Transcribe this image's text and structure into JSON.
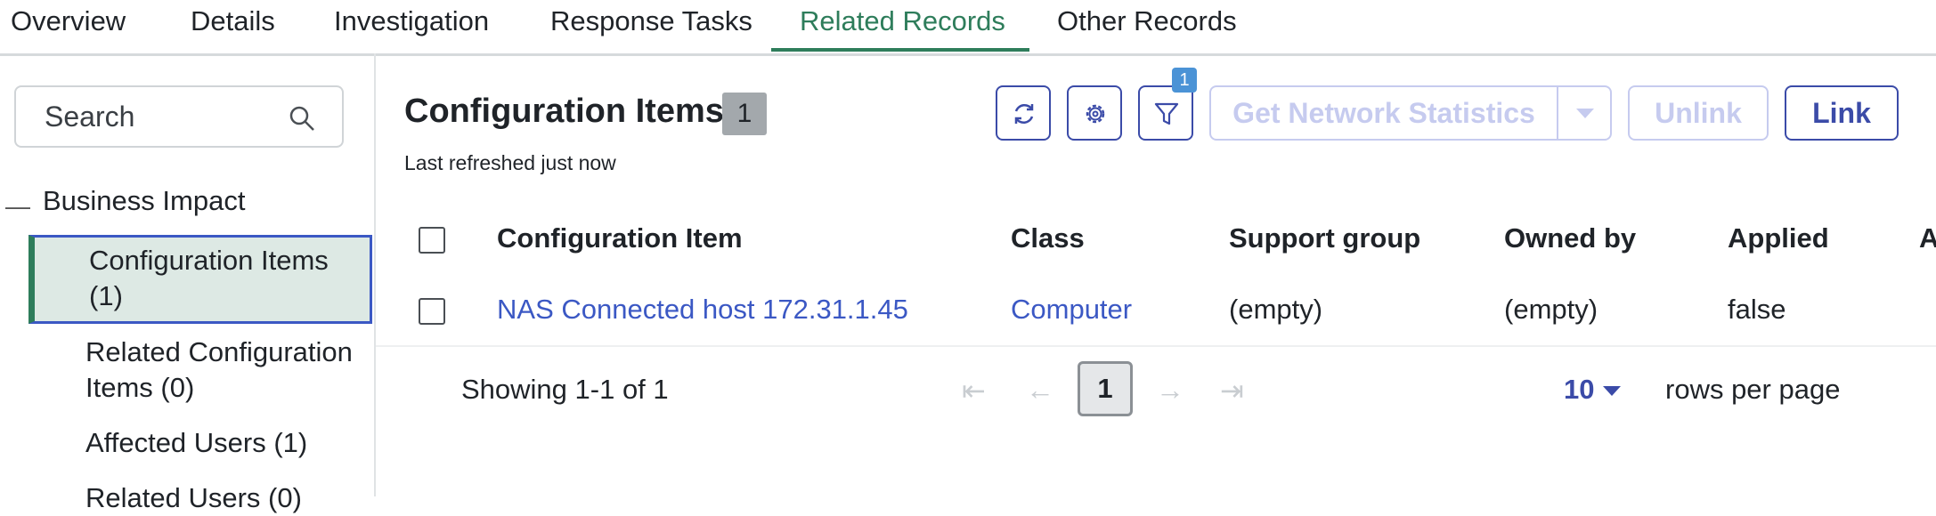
{
  "tabs": [
    {
      "label": "Overview"
    },
    {
      "label": "Details"
    },
    {
      "label": "Investigation"
    },
    {
      "label": "Response Tasks"
    },
    {
      "label": "Related Records",
      "active": true
    },
    {
      "label": "Other Records"
    }
  ],
  "sidebar": {
    "search_text": "Search",
    "group_label": "Business Impact",
    "items": [
      {
        "label": "Configuration Items (1)",
        "selected": true
      },
      {
        "label": "Related Configuration Items (0)"
      },
      {
        "label": "Affected Users (1)"
      },
      {
        "label": "Related Users (0)"
      }
    ]
  },
  "main": {
    "title": "Configuration Items",
    "count": "1",
    "refreshed": "Last refreshed just now",
    "filter_count": "1",
    "buttons": {
      "network_stats": "Get Network Statistics",
      "unlink": "Unlink",
      "link": "Link"
    }
  },
  "table": {
    "columns": [
      "Configuration Item",
      "Class",
      "Support group",
      "Owned by",
      "Applied",
      "A"
    ],
    "rows": [
      [
        "NAS Connected host 172.31.1.45",
        "Computer",
        "(empty)",
        "(empty)",
        "false"
      ]
    ]
  },
  "pagination": {
    "showing": "Showing 1-1 of 1",
    "page": "1",
    "rows_per_page": "10",
    "rows_label": "rows per page"
  },
  "colors": {
    "accent_green": "#2e7d5b",
    "link_blue": "#3b58c4",
    "button_blue": "#3b4ba8"
  }
}
